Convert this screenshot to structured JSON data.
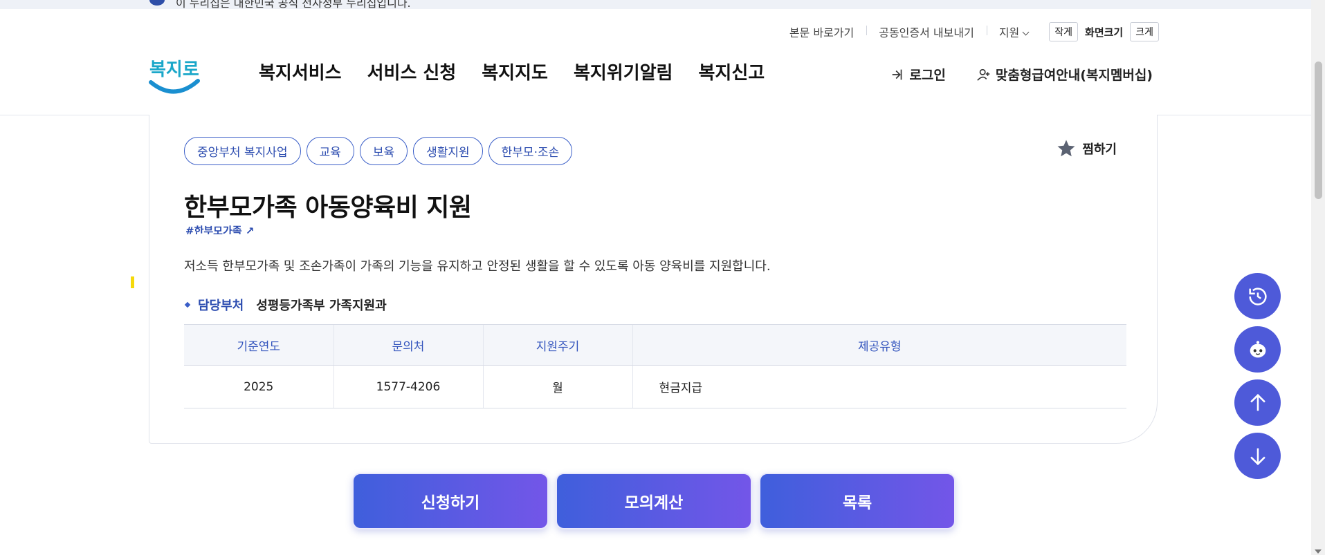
{
  "banner": {
    "text": "이 누리집은 대한민국 공식 전자정부 누리집입니다."
  },
  "util": {
    "skip_link": "본문 바로가기",
    "cert_export": "공동인증서 내보내기",
    "support": "지원",
    "small": "작게",
    "screen_size": "화면크기",
    "large": "크게"
  },
  "logo": {
    "text": "복지로"
  },
  "nav": [
    "복지서비스",
    "서비스 신청",
    "복지지도",
    "복지위기알림",
    "복지신고"
  ],
  "auth": {
    "login": "로그인",
    "membership": "맞춤형급여안내(복지멤버십)"
  },
  "tags": [
    "중앙부처 복지사업",
    "교육",
    "보육",
    "생활지원",
    "한부모·조손"
  ],
  "favorite": {
    "label": "찜하기"
  },
  "service": {
    "title": "한부모가족 아동양육비 지원",
    "hashtag": "#한부모가족",
    "description": "저소득 한부모가족 및 조손가족이 가족의 기능을 유지하고 안정된 생활을 할 수 있도록 아동 양육비를 지원합니다.",
    "dept_label": "담당부처",
    "dept_value": "성평등가족부 가족지원과"
  },
  "table": {
    "headers": [
      "기준연도",
      "문의처",
      "지원주기",
      "제공유형"
    ],
    "row": [
      "2025",
      "1577-4206",
      "월",
      "현금지급"
    ]
  },
  "actions": {
    "apply": "신청하기",
    "simulate": "모의계산",
    "list": "목록"
  },
  "colors": {
    "primary": "#3f5fdc",
    "accent": "#7356e8",
    "fab": "#4e5ad9",
    "tag_border": "#3a5ec8"
  }
}
